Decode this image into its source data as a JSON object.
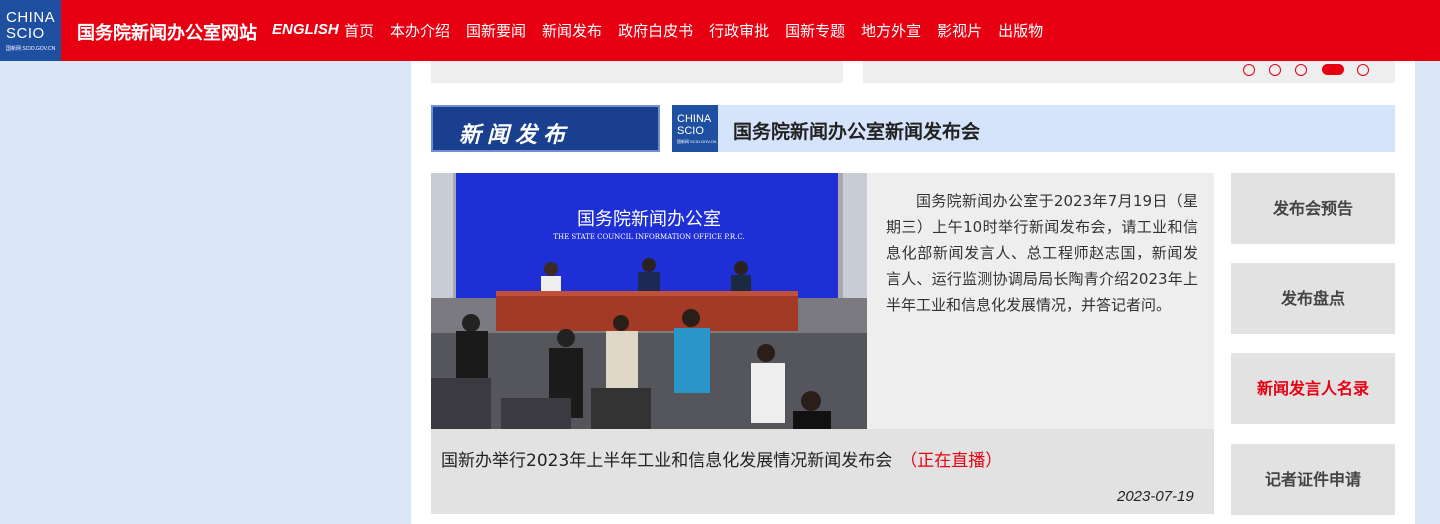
{
  "header": {
    "logo_line1": "CHINA",
    "logo_line2": "SCIO",
    "logo_line3": "国新网 SCIO.GOV.CN",
    "site_title": "国务院新闻办公室网站",
    "english_link": "ENGLISH",
    "nav": [
      "首页",
      "本办介绍",
      "国新要闻",
      "新闻发布",
      "政府白皮书",
      "行政审批",
      "国新专题",
      "地方外宣",
      "影视片",
      "出版物"
    ],
    "brand_color": "#e60012"
  },
  "carousel": {
    "dots": 5,
    "active_index": 3
  },
  "news_section": {
    "tab_label": "新闻发布",
    "pc_logo_line1": "CHINA",
    "pc_logo_line2": "SCIO",
    "pc_logo_line3": "国新网 SCIO.GOV.CN",
    "press_conference_title": "国务院新闻办公室新闻发布会"
  },
  "photo": {
    "backdrop_title": "国务院新闻办公室",
    "backdrop_subtitle": "THE STATE COUNCIL INFORMATION OFFICE P.R.C."
  },
  "feature": {
    "summary": "国务院新闻办公室于2023年7月19日（星期三）上午10时举行新闻发布会，请工业和信息化部新闻发言人、总工程师赵志国，新闻发言人、运行监测协调局局长陶青介绍2023年上半年工业和信息化发展情况，并答记者问。",
    "headline": "国新办举行2023年上半年工业和信息化发展情况新闻发布会",
    "live_label": "（正在直播）",
    "date": "2023-07-19"
  },
  "side_buttons": [
    {
      "label": "发布会预告",
      "highlight": false
    },
    {
      "label": "发布盘点",
      "highlight": false
    },
    {
      "label": "新闻发言人名录",
      "highlight": true
    },
    {
      "label": "记者证件申请",
      "highlight": false
    }
  ]
}
